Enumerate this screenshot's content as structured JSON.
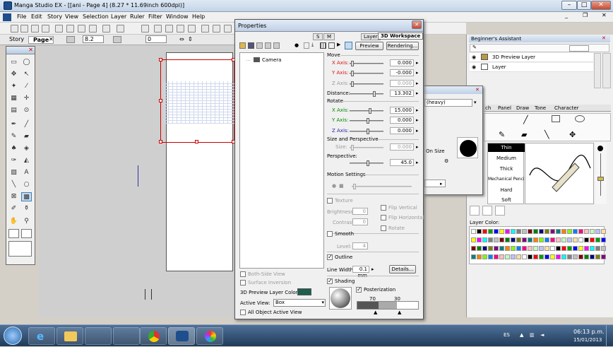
{
  "window": {
    "title": "Manga Studio EX - [[ani - Page 4] (8.27 * 11.69inch 600dpi)]"
  },
  "menu": [
    "File",
    "Edit",
    "Story",
    "View",
    "Selection",
    "Layer",
    "Ruler",
    "Filter",
    "Window",
    "Help"
  ],
  "toolbar": {
    "zoom_value": "8.2",
    "angle_value": "0"
  },
  "doc_tabs": [
    "Story",
    "Page"
  ],
  "properties": {
    "title": "Properties",
    "tabs": [
      "S",
      "M",
      "Layer",
      "3D Workspace"
    ],
    "preview_label": "Preview",
    "rendering_label": "Rendering...",
    "tree_item": "Camera",
    "move_label": "Move",
    "x_axis_label": "X Axis:",
    "y_axis_label": "Y Axis:",
    "z_axis_label": "Z Axis:",
    "move_x": "0.000",
    "move_y": "-0.000",
    "move_z": "0.000",
    "distance_label": "Distance:",
    "distance": "13.302",
    "rotate_label": "Rotate",
    "rot_x": "15.000",
    "rot_y": "0.000",
    "rot_z": "0.000",
    "size_persp_label": "Size and Perspective",
    "size_label": "Size:",
    "size": "0.000",
    "perspective_label": "Perspective:",
    "perspective": "45.0",
    "motion_label": "Motion Settings",
    "texture_label": "Texture",
    "brightness_label": "Brightness:",
    "brightness": "0",
    "contrast_label": "Contrast:",
    "contrast": "0",
    "flip_vertical": "Flip Vertical",
    "flip_horizontal": "Flip Horizontal",
    "rotate_cb": "Rotate",
    "smooth_label": "Smooth",
    "level_label": "Level:",
    "level": "4",
    "outline_label": "Outline",
    "line_width_label": "Line Width:",
    "line_width": "0.1 mm",
    "details_label": "Details...",
    "shading_label": "Shading",
    "posterization_label": "Posterization",
    "poster_low": "70",
    "poster_high": "30",
    "both_side_view": "Both-Side View",
    "surface_inversion": "Surface Inversion",
    "layer_color_label": "3D Preview Layer Color:",
    "layer_color": "#1e5e4c",
    "active_view_label": "Active View:",
    "active_view": "Box",
    "all_object_view": "All Object Active View"
  },
  "assistant": {
    "title": "Beginner's Assistant",
    "layers": [
      {
        "name": "3D Preview Layer"
      },
      {
        "name": "Layer"
      }
    ]
  },
  "mid_panel": {
    "dropdown": "(heavy)",
    "on_size": "On Size"
  },
  "tool_settings": {
    "tabs": [
      "ch",
      "Panel",
      "Draw",
      "Tone",
      "Character"
    ],
    "pen_list": [
      "Thin",
      "Medium",
      "Thick",
      "Mechanical Pencil",
      "Hard",
      "Soft"
    ],
    "selected": "Thin",
    "layer_color_label": "Layer Color:"
  },
  "palette": [
    "#ffffff",
    "#000000",
    "#ff0000",
    "#00a000",
    "#0000ff",
    "#ffff00",
    "#ff00ff",
    "#00ffff",
    "#808080",
    "#c0c0c0",
    "#800000",
    "#008000",
    "#000080",
    "#808000",
    "#800080",
    "#008080",
    "#ff8000",
    "#80ff00",
    "#0080ff",
    "#ff0080",
    "#ffc0c0",
    "#c0ffc0",
    "#c0c0ff",
    "#ffe0a0"
  ],
  "taskbar": {
    "lang": "ES",
    "time": "06:13 p.m.",
    "date": "15/01/2013"
  },
  "colors": {
    "accent": "#3c7fb1",
    "selection_red": "#cc0000"
  }
}
